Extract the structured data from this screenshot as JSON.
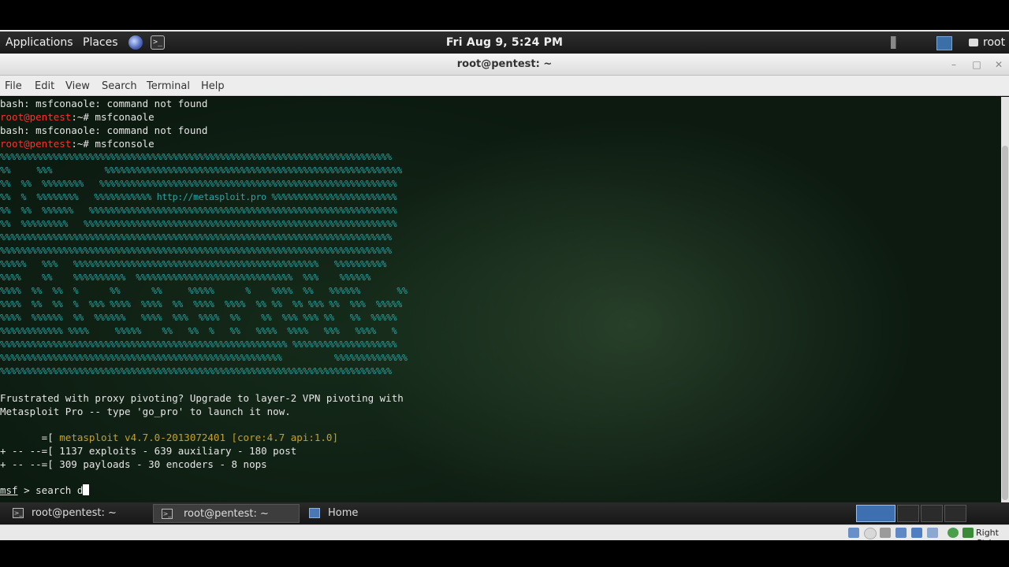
{
  "top_panel": {
    "applications": "Applications",
    "places": "Places",
    "clock": "Fri Aug  9,  5:24 PM",
    "user": "root",
    "icons": [
      "browser-icon",
      "terminal-launcher-icon",
      "volume-muted-icon",
      "network-icon",
      "chat-icon"
    ]
  },
  "window": {
    "title": "root@pentest: ~",
    "controls": {
      "minimize": "–",
      "maximize": "□",
      "close": "✕"
    }
  },
  "menu": [
    "File",
    "Edit",
    "View",
    "Search",
    "Terminal",
    "Help"
  ],
  "terminal": {
    "history": [
      {
        "type": "out",
        "text": "bash: msfconaole: command not found"
      },
      {
        "type": "prompt",
        "user": "root@pentest",
        "rest": ":~# ",
        "cmd": "msfconaole"
      },
      {
        "type": "out",
        "text": "bash: msfconaole: command not found"
      },
      {
        "type": "prompt",
        "user": "root@pentest",
        "rest": ":~# ",
        "cmd": "msfconsole"
      }
    ],
    "ascii_art": [
      "%%%%%%%%%%%%%%%%%%%%%%%%%%%%%%%%%%%%%%%%%%%%%%%%%%%%%%%%%%%%%%%%%%%%%%%%%%%",
      "%%     %%%          %%%%%%%%%%%%%%%%%%%%%%%%%%%%%%%%%%%%%%%%%%%%%%%%%%%%%%%%%",
      "%%  %%  %%%%%%%%   %%%%%%%%%%%%%%%%%%%%%%%%%%%%%%%%%%%%%%%%%%%%%%%%%%%%%%%%%",
      "%%  %  %%%%%%%%   %%%%%%%%%%% http://metasploit.pro %%%%%%%%%%%%%%%%%%%%%%%%",
      "%%  %%  %%%%%%   %%%%%%%%%%%%%%%%%%%%%%%%%%%%%%%%%%%%%%%%%%%%%%%%%%%%%%%%%%%",
      "%%  %%%%%%%%%   %%%%%%%%%%%%%%%%%%%%%%%%%%%%%%%%%%%%%%%%%%%%%%%%%%%%%%%%%%%%",
      "%%%%%%%%%%%%%%%%%%%%%%%%%%%%%%%%%%%%%%%%%%%%%%%%%%%%%%%%%%%%%%%%%%%%%%%%%%%",
      "%%%%%%%%%%%%%%%%%%%%%%%%%%%%%%%%%%%%%%%%%%%%%%%%%%%%%%%%%%%%%%%%%%%%%%%%%%%",
      "%%%%%   %%%   %%%%%%%%%%%%%%%%%%%%%%%%%%%%%%%%%%%%%%%%%%%%%%%   %%%%%%%%%%",
      "%%%%    %%    %%%%%%%%%%  %%%%%%%%%%%%%%%%%%%%%%%%%%%%%%  %%%    %%%%%%",
      "%%%%  %%  %%  %      %%      %%     %%%%%      %    %%%%  %%   %%%%%%       %%",
      "%%%%  %%  %%  %  %%% %%%%  %%%%  %%  %%%%  %%%%  %% %%  %% %%% %%  %%%  %%%%%",
      "%%%%  %%%%%%  %%  %%%%%%   %%%%  %%%  %%%%  %%    %%  %%% %%% %%   %%  %%%%%",
      "%%%%%%%%%%%% %%%%     %%%%%    %%   %%  %   %%   %%%%  %%%%   %%%   %%%%   %",
      "%%%%%%%%%%%%%%%%%%%%%%%%%%%%%%%%%%%%%%%%%%%%%%%%%%%%%%% %%%%%%%%%%%%%%%%%%%%",
      "%%%%%%%%%%%%%%%%%%%%%%%%%%%%%%%%%%%%%%%%%%%%%%%%%%%%%%          %%%%%%%%%%%%%%",
      "%%%%%%%%%%%%%%%%%%%%%%%%%%%%%%%%%%%%%%%%%%%%%%%%%%%%%%%%%%%%%%%%%%%%%%%%%%%"
    ],
    "pro_ad_1": "Frustrated with proxy pivoting? Upgrade to layer-2 VPN pivoting with",
    "pro_ad_2": "Metasploit Pro -- type 'go_pro' to launch it now.",
    "banner_1_prefix": "       =[ ",
    "banner_1_version": "metasploit v4.7.0-2013072401 [core:4.7 api:1.0]",
    "banner_2": "+ -- --=[ 1137 exploits - 639 auxiliary - 180 post",
    "banner_3": "+ -- --=[ 309 payloads - 30 encoders - 8 nops",
    "msf_prompt": "msf",
    "msf_prompt_sep": " > ",
    "current_input": "search d"
  },
  "taskbar": {
    "tasks": [
      {
        "label": "root@pentest: ~",
        "icon": "terminal-icon",
        "active": false
      },
      {
        "label": "root@pentest: ~",
        "icon": "terminal-icon",
        "active": true
      },
      {
        "label": "Home",
        "icon": "folder-icon",
        "active": false
      }
    ]
  },
  "vbox_status": {
    "host_key": "Right Ctrl",
    "icons": [
      "hdd-icon",
      "cdrom-icon",
      "usb-icon",
      "network-adapter-icon",
      "shared-folder-icon",
      "display-icon",
      "capture-icon",
      "mouse-integration-icon"
    ]
  }
}
